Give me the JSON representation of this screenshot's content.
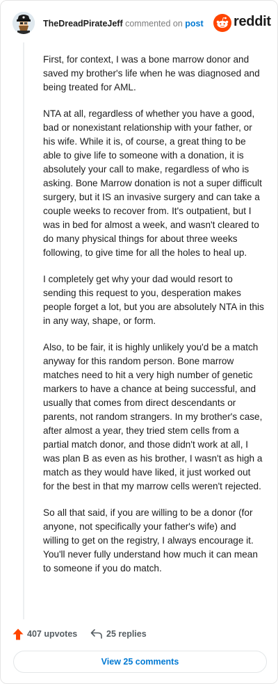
{
  "header": {
    "author": "TheDreadPirateJeff",
    "action_text": "commented on",
    "post_link": "post",
    "brand": "reddit"
  },
  "comment": {
    "paragraphs": [
      "First, for context, I was a bone marrow donor and saved my brother's life when he was diagnosed and being treated for AML.",
      "NTA at all, regardless of whether you have a good, bad or nonexistant relationship with your father, or his wife. While it is, of course, a great thing to be able to give life to someone with a donation, it is absolutely your call to make, regardless of who is asking. Bone Marrow donation is not a super difficult surgery, but it IS an invasive surgery and can take a couple weeks to recover from. It's outpatient, but I was in bed for almost a week, and wasn't cleared to do many physical things for about three weeks following, to give time for all the holes to heal up.",
      "I completely get why your dad would resort to sending this request to you, desperation makes people forget a lot, but you are absolutely NTA in this in any way, shape, or form.",
      "Also, to be fair, it is highly unlikely you'd be a match anyway for this random person. Bone marrow matches need to hit a very high number of genetic markers to have a chance at being successful, and usually that comes from direct descendants or parents, not random strangers. In my brother's case, after almost a year, they tried stem cells from a partial match donor, and those didn't work at all, I was plan B as even as his brother, I wasn't as high a match as they would have liked, it just worked out for the best in that my marrow cells weren't rejected.",
      "So all that said, if you are willing to be a donor (for anyone, not specifically your father's wife) and willing to get on the registry, I always encourage it. You'll never fully understand how much it can mean to someone if you do match."
    ]
  },
  "actions": {
    "upvotes": "407 upvotes",
    "replies": "25 replies",
    "view_comments": "View 25 comments"
  },
  "colors": {
    "accent_link": "#0079d3",
    "brand_orange": "#ff4500",
    "upvote_orange": "#ff4500"
  },
  "icons": [
    "avatar",
    "reddit-logo-icon",
    "upvote-arrow-icon",
    "reply-arrow-icon"
  ]
}
